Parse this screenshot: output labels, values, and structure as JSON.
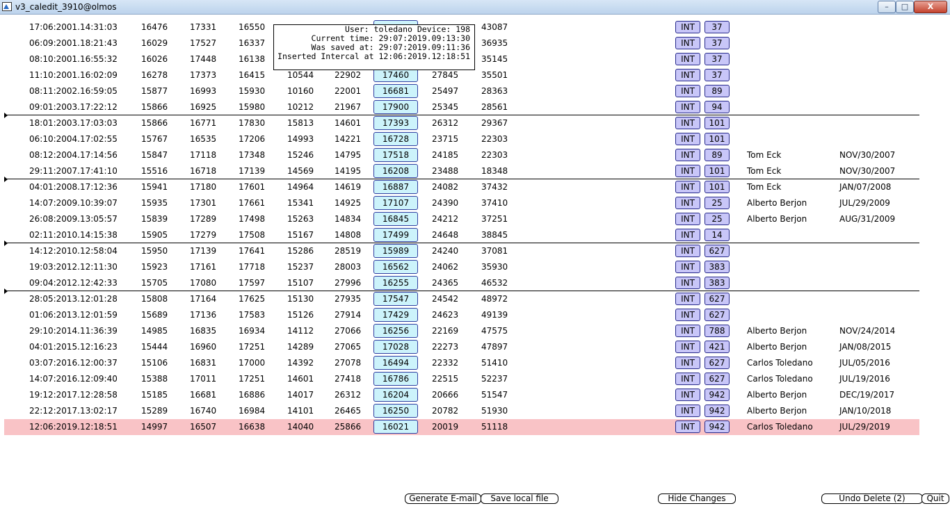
{
  "window": {
    "title": "v3_caledit_3910@olmos",
    "min_label": "–",
    "max_label": "□",
    "close_label": "X"
  },
  "popup": {
    "line1": "User: toledano Device: 198",
    "line2": "Current time: 29:07:2019.09:13:30",
    "line3": "Was saved at: 29:07:2019.09:11:36",
    "line4": "Inserted Intercal at 12:06:2019.12:18:51"
  },
  "rows": [
    {
      "date": "17:06:2001.14:31:03",
      "n1": "16476",
      "n2": "17331",
      "n3": "16550",
      "n4": "",
      "n5": "",
      "box": "",
      "n6": "",
      "n7": "43087",
      "int": "INT",
      "num": "37",
      "name": "",
      "date2": ""
    },
    {
      "date": "06:09:2001.18:21:43",
      "n1": "16029",
      "n2": "17527",
      "n3": "16337",
      "n4": "",
      "n5": "",
      "box": "",
      "n6": "",
      "n7": "36935",
      "int": "INT",
      "num": "37",
      "name": "",
      "date2": ""
    },
    {
      "date": "08:10:2001.16:55:32",
      "n1": "16026",
      "n2": "17448",
      "n3": "16138",
      "n4": "",
      "n5": "",
      "box": "",
      "n6": "",
      "n7": "35145",
      "int": "INT",
      "num": "37",
      "name": "",
      "date2": ""
    },
    {
      "date": "11:10:2001.16:02:09",
      "n1": "16278",
      "n2": "17373",
      "n3": "16415",
      "n4": "10544",
      "n5": "22902",
      "box": "17460",
      "n6": "27845",
      "n7": "35501",
      "int": "INT",
      "num": "37",
      "name": "",
      "date2": ""
    },
    {
      "date": "08:11:2002.16:59:05",
      "n1": "15877",
      "n2": "16993",
      "n3": "15930",
      "n4": "10160",
      "n5": "22001",
      "box": "16681",
      "n6": "25497",
      "n7": "28363",
      "int": "INT",
      "num": "89",
      "name": "",
      "date2": ""
    },
    {
      "date": "09:01:2003.17:22:12",
      "n1": "15866",
      "n2": "16925",
      "n3": "15980",
      "n4": "10212",
      "n5": "21967",
      "box": "17900",
      "n6": "25345",
      "n7": "28561",
      "int": "INT",
      "num": "94",
      "name": "",
      "date2": ""
    },
    {
      "date": "18:01:2003.17:03:03",
      "n1": "15866",
      "n2": "16771",
      "n3": "17830",
      "n4": "15813",
      "n5": "14601",
      "box": "17393",
      "n6": "26312",
      "n7": "29367",
      "int": "INT",
      "num": "101",
      "name": "",
      "date2": ""
    },
    {
      "date": "06:10:2004.17:02:55",
      "n1": "15767",
      "n2": "16535",
      "n3": "17206",
      "n4": "14993",
      "n5": "14221",
      "box": "16728",
      "n6": "23715",
      "n7": "22303",
      "int": "INT",
      "num": "101",
      "name": "",
      "date2": ""
    },
    {
      "date": "08:12:2004.17:14:56",
      "n1": "15847",
      "n2": "17118",
      "n3": "17348",
      "n4": "15246",
      "n5": "14795",
      "box": "17518",
      "n6": "24185",
      "n7": "22303",
      "int": "INT",
      "num": "89",
      "name": "Tom Eck",
      "date2": "NOV/30/2007"
    },
    {
      "date": "29:11:2007.17:41:10",
      "n1": "15516",
      "n2": "16718",
      "n3": "17139",
      "n4": "14569",
      "n5": "14195",
      "box": "16208",
      "n6": "23488",
      "n7": "18348",
      "int": "INT",
      "num": "101",
      "name": "Tom Eck",
      "date2": "NOV/30/2007"
    },
    {
      "date": "04:01:2008.17:12:36",
      "n1": "15941",
      "n2": "17180",
      "n3": "17601",
      "n4": "14964",
      "n5": "14619",
      "box": "16887",
      "n6": "24082",
      "n7": "37432",
      "int": "INT",
      "num": "101",
      "name": "Tom Eck",
      "date2": "JAN/07/2008"
    },
    {
      "date": "14:07:2009.10:39:07",
      "n1": "15935",
      "n2": "17301",
      "n3": "17661",
      "n4": "15341",
      "n5": "14925",
      "box": "17107",
      "n6": "24390",
      "n7": "37410",
      "int": "INT",
      "num": "25",
      "name": "Alberto Berjon",
      "date2": "JUL/29/2009"
    },
    {
      "date": "26:08:2009.13:05:57",
      "n1": "15839",
      "n2": "17289",
      "n3": "17498",
      "n4": "15263",
      "n5": "14834",
      "box": "16845",
      "n6": "24212",
      "n7": "37251",
      "int": "INT",
      "num": "25",
      "name": "Alberto Berjon",
      "date2": "AUG/31/2009"
    },
    {
      "date": "02:11:2010.14:15:38",
      "n1": "15905",
      "n2": "17279",
      "n3": "17508",
      "n4": "15167",
      "n5": "14808",
      "box": "17499",
      "n6": "24648",
      "n7": "38845",
      "int": "INT",
      "num": "14",
      "name": "",
      "date2": ""
    },
    {
      "date": "14:12:2010.12:58:04",
      "n1": "15950",
      "n2": "17139",
      "n3": "17641",
      "n4": "15286",
      "n5": "28519",
      "box": "15989",
      "n6": "24240",
      "n7": "37081",
      "int": "INT",
      "num": "627",
      "name": "",
      "date2": ""
    },
    {
      "date": "19:03:2012.12:11:30",
      "n1": "15923",
      "n2": "17161",
      "n3": "17718",
      "n4": "15237",
      "n5": "28003",
      "box": "16562",
      "n6": "24062",
      "n7": "35930",
      "int": "INT",
      "num": "383",
      "name": "",
      "date2": ""
    },
    {
      "date": "09:04:2012.12:42:33",
      "n1": "15705",
      "n2": "17080",
      "n3": "17597",
      "n4": "15107",
      "n5": "27996",
      "box": "16255",
      "n6": "24365",
      "n7": "46532",
      "int": "INT",
      "num": "383",
      "name": "",
      "date2": ""
    },
    {
      "date": "28:05:2013.12:01:28",
      "n1": "15808",
      "n2": "17164",
      "n3": "17625",
      "n4": "15130",
      "n5": "27935",
      "box": "17547",
      "n6": "24542",
      "n7": "48972",
      "int": "INT",
      "num": "627",
      "name": "",
      "date2": ""
    },
    {
      "date": "01:06:2013.12:01:59",
      "n1": "15689",
      "n2": "17136",
      "n3": "17583",
      "n4": "15126",
      "n5": "27914",
      "box": "17429",
      "n6": "24623",
      "n7": "49139",
      "int": "INT",
      "num": "627",
      "name": "",
      "date2": ""
    },
    {
      "date": "29:10:2014.11:36:39",
      "n1": "14985",
      "n2": "16835",
      "n3": "16934",
      "n4": "14112",
      "n5": "27066",
      "box": "16256",
      "n6": "22169",
      "n7": "47575",
      "int": "INT",
      "num": "788",
      "name": "Alberto Berjon",
      "date2": "NOV/24/2014"
    },
    {
      "date": "04:01:2015.12:16:23",
      "n1": "15444",
      "n2": "16960",
      "n3": "17251",
      "n4": "14289",
      "n5": "27065",
      "box": "17028",
      "n6": "22273",
      "n7": "47897",
      "int": "INT",
      "num": "421",
      "name": "Alberto Berjon",
      "date2": "JAN/08/2015"
    },
    {
      "date": "03:07:2016.12:00:37",
      "n1": "15106",
      "n2": "16831",
      "n3": "17000",
      "n4": "14392",
      "n5": "27078",
      "box": "16494",
      "n6": "22332",
      "n7": "51410",
      "int": "INT",
      "num": "627",
      "name": "Carlos Toledano",
      "date2": "JUL/05/2016"
    },
    {
      "date": "14:07:2016.12:09:40",
      "n1": "15388",
      "n2": "17011",
      "n3": "17251",
      "n4": "14601",
      "n5": "27418",
      "box": "16786",
      "n6": "22515",
      "n7": "52237",
      "int": "INT",
      "num": "627",
      "name": "Carlos Toledano",
      "date2": "JUL/19/2016"
    },
    {
      "date": "19:12:2017.12:28:58",
      "n1": "15185",
      "n2": "16681",
      "n3": "16886",
      "n4": "14017",
      "n5": "26312",
      "box": "16204",
      "n6": "20666",
      "n7": "51547",
      "int": "INT",
      "num": "942",
      "name": "Alberto Berjon",
      "date2": "DEC/19/2017"
    },
    {
      "date": "22:12:2017.13:02:17",
      "n1": "15289",
      "n2": "16740",
      "n3": "16984",
      "n4": "14101",
      "n5": "26465",
      "box": "16250",
      "n6": "20782",
      "n7": "51930",
      "int": "INT",
      "num": "942",
      "name": "Alberto Berjon",
      "date2": "JAN/10/2018"
    },
    {
      "date": "12:06:2019.12:18:51",
      "n1": "14997",
      "n2": "16507",
      "n3": "16638",
      "n4": "14040",
      "n5": "25866",
      "box": "16021",
      "n6": "20019",
      "n7": "51118",
      "int": "INT",
      "num": "942",
      "name": "Carlos Toledano",
      "date2": "JUL/29/2019",
      "highlight": true
    }
  ],
  "separators_after_row": [
    5,
    9,
    13,
    16
  ],
  "buttons": {
    "email": "Generate E-mail",
    "save": "Save local file",
    "hide": "Hide Changes",
    "undo": "Undo Delete (2)",
    "quit": "Quit"
  }
}
